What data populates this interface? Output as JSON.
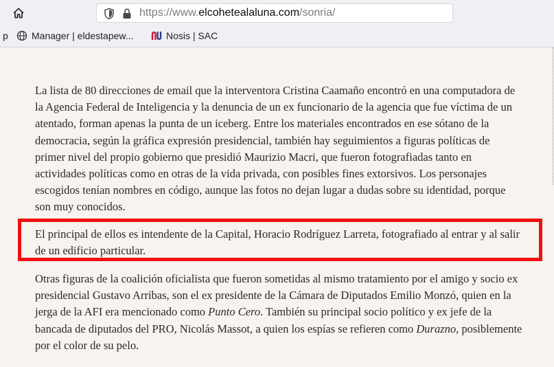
{
  "browser": {
    "url_prefix": "https://www.",
    "url_host": "elcohetealaluna.com",
    "url_path": "/sonria/",
    "bookmarks": [
      {
        "label": "p"
      },
      {
        "label": "Manager | eldestapew..."
      },
      {
        "label": "Nosis | SAC"
      }
    ]
  },
  "article": {
    "p1": "La lista de 80 direcciones de email que la interventora Cristina Caamaño encontró en una computadora de la Agencia Federal de Inteligencia y la denuncia de un ex funcionario de la agencia que fue víctima de un atentado, forman apenas la punta de un iceberg. Entre los materiales encontrados en ese sótano de la democracia, según la gráfica expresión presidencial, también hay seguimientos a figuras políticas de primer nivel del propio gobierno que presidió Maurizio Macri, que fueron fotografiadas tanto en actividades políticas como en otras de la vida privada, con posibles fines extorsivos. Los personajes escogidos tenían nombres en código, aunque las fotos no dejan lugar a dudas sobre su identidad, porque son muy conocidos.",
    "p2": "El principal de ellos es intendente de la Capital, Horacio Rodríguez Larreta, fotografiado al entrar y al salir de un edificio particular.",
    "p3_a": "Otras figuras de la coalición oficialista que fueron sometidas al mismo tratamiento por el amigo y socio ex presidencial Gustavo Arribas, son el ex presidente de la Cámara de Diputados Emilio Monzó, quien en la jerga de la AFI era mencionado como ",
    "p3_em1": "Punto Cero",
    "p3_b": ". También su principal socio político y ex jefe de la bancada de diputados del PRO, Nicolás Massot, a quien los espías se refieren como ",
    "p3_em2": "Durazno",
    "p3_c": ", posiblemente por el color de su pelo."
  },
  "colors": {
    "highlight_border": "#ee1111",
    "page_background": "#f7f3ee"
  }
}
